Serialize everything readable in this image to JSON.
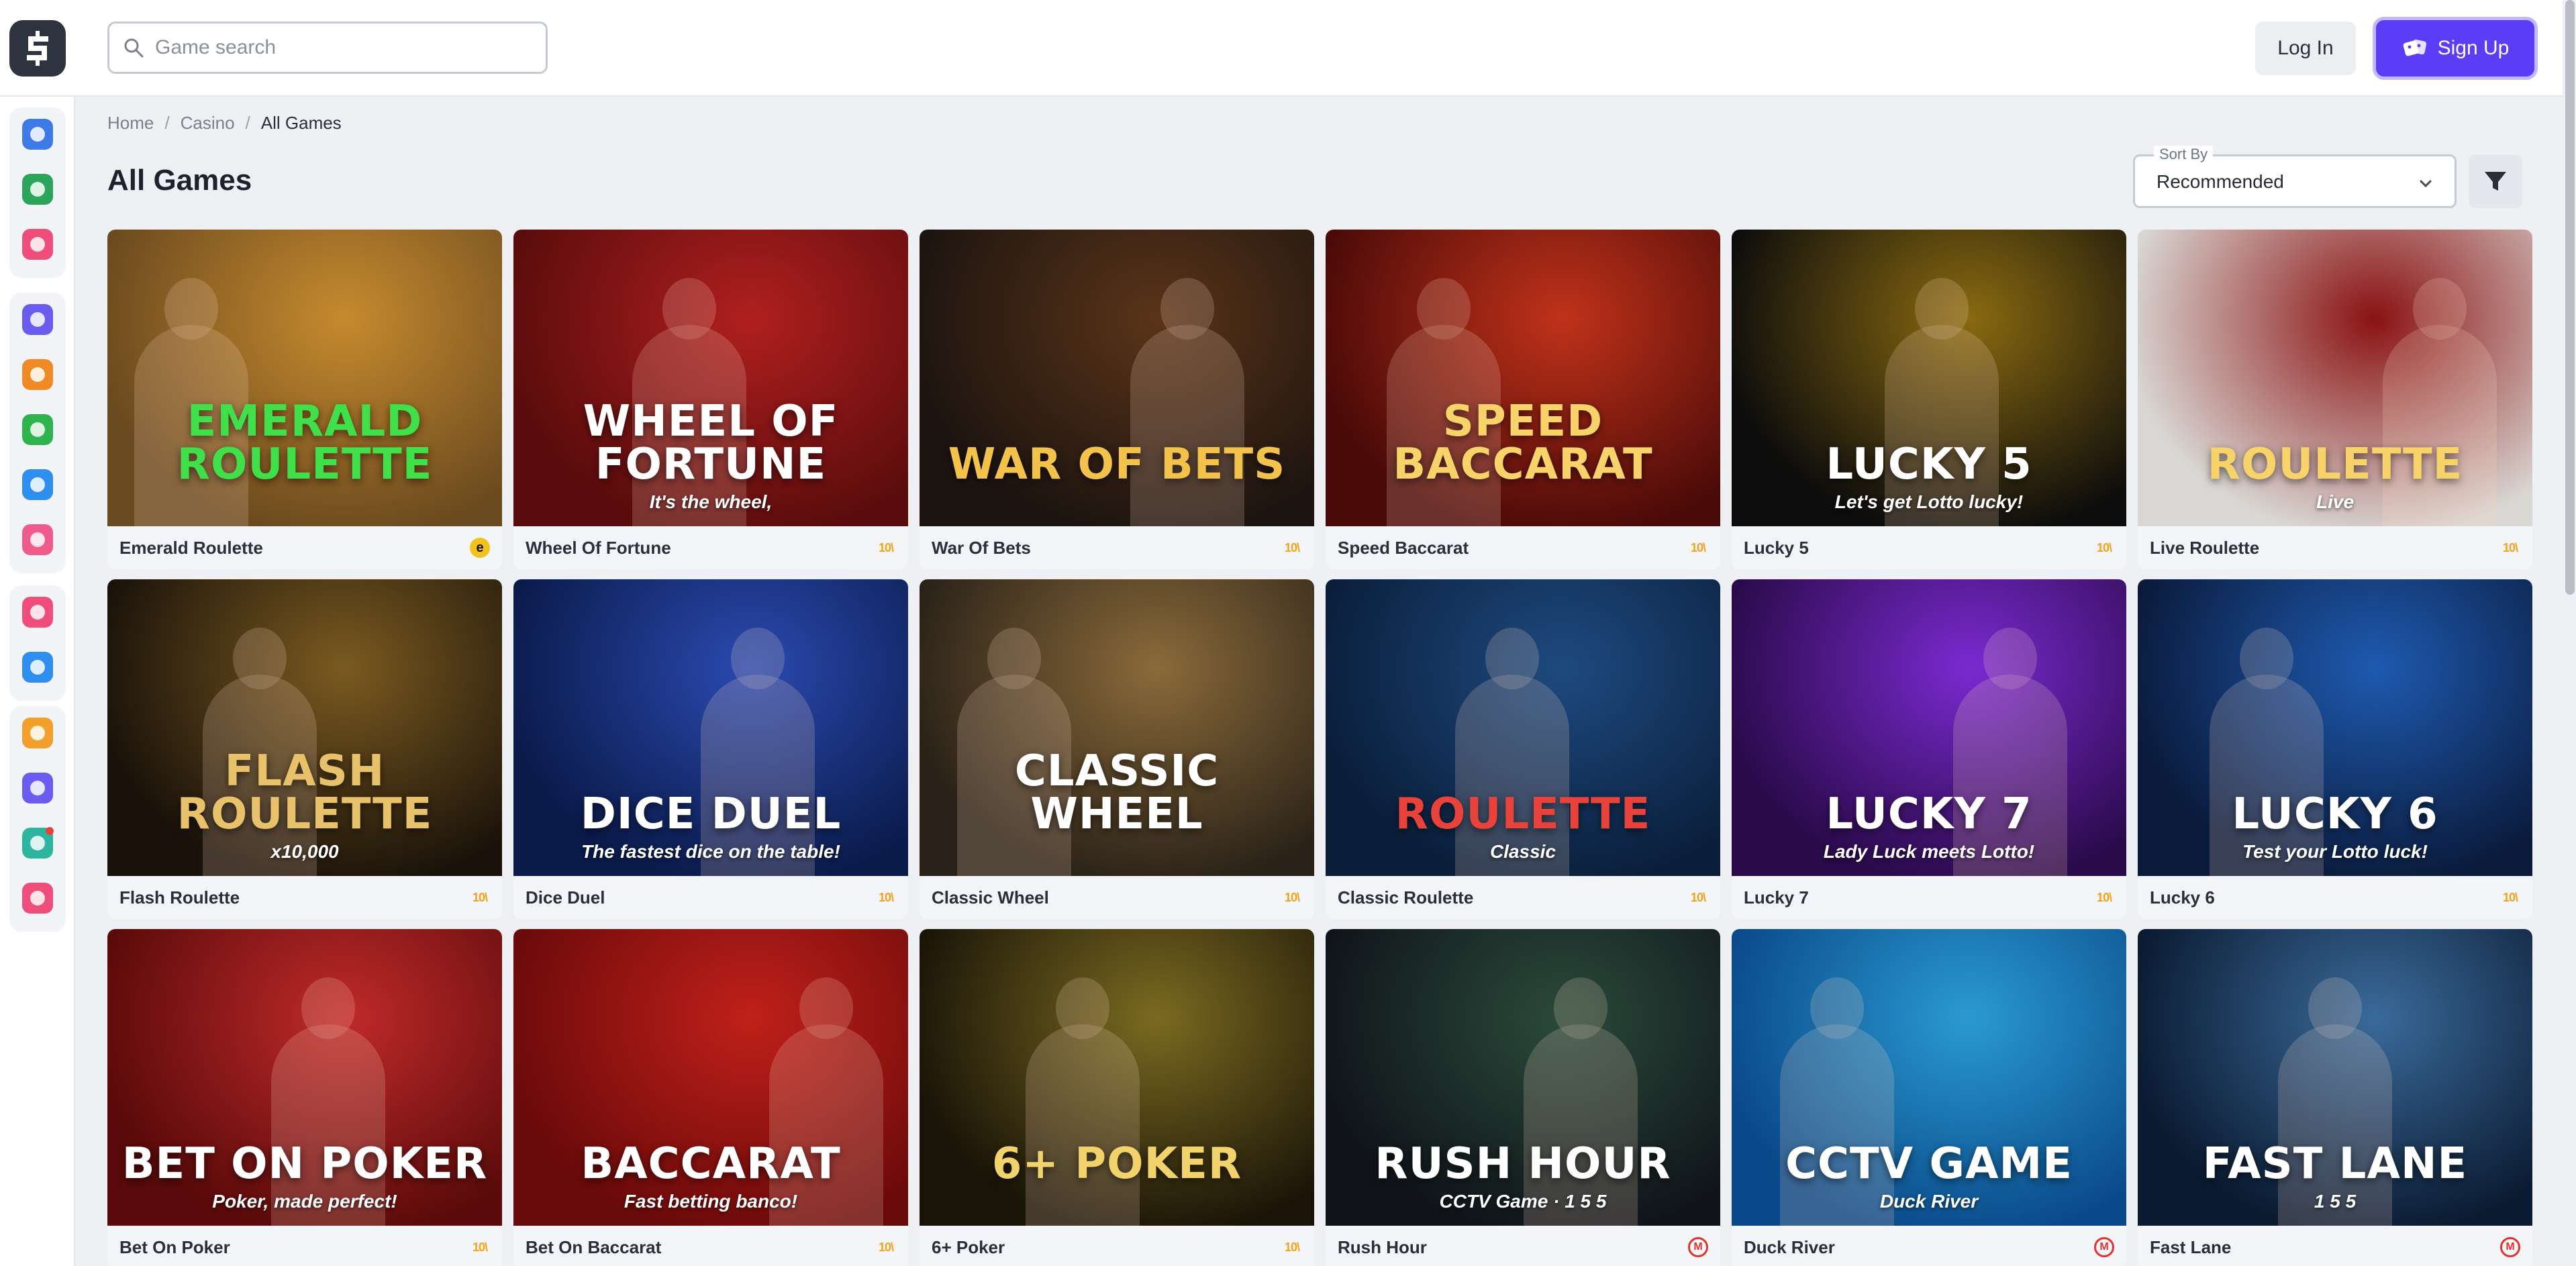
{
  "header": {
    "search_placeholder": "Game search",
    "login_label": "Log In",
    "signup_label": "Sign Up"
  },
  "sidebar": {
    "items": [
      {
        "icon": "dice-icon",
        "color": "#3d7be8"
      },
      {
        "icon": "chip-icon",
        "color": "#2aa55a"
      },
      {
        "icon": "heart-icon",
        "color": "#ef4e7b"
      },
      {
        "icon": "grid-icon",
        "color": "#6a5cf0"
      },
      {
        "icon": "trophy-icon",
        "color": "#f08a24"
      },
      {
        "icon": "percent-icon",
        "color": "#2fb34d"
      },
      {
        "icon": "target-icon",
        "color": "#2f8ff0"
      },
      {
        "icon": "cards-icon",
        "color": "#ef5b8a"
      },
      {
        "icon": "gift-icon",
        "color": "#ef4e7b"
      },
      {
        "icon": "coins-icon",
        "color": "#2f8ff0"
      },
      {
        "icon": "vip-icon",
        "color": "#f2a02a"
      },
      {
        "icon": "calendar-icon",
        "color": "#6a5cf0"
      },
      {
        "icon": "news-icon",
        "color": "#2cb59f"
      },
      {
        "icon": "chat-icon",
        "color": "#ef4e7b"
      }
    ]
  },
  "breadcrumb": {
    "home": "Home",
    "casino": "Casino",
    "current": "All Games",
    "separator": "/"
  },
  "page": {
    "title": "All Games",
    "sort_legend": "Sort By",
    "sort_value": "Recommended"
  },
  "games": [
    {
      "name": "Emerald Roulette",
      "art": "Emerald Roulette",
      "sub": "",
      "provider": "evo",
      "bg1": "#6b4a1f",
      "bg2": "#c68a2e",
      "title_color": "#3fe04a"
    },
    {
      "name": "Wheel Of Fortune",
      "art": "Wheel Of Fortune",
      "sub": "It's the wheel,",
      "provider": "ezugi",
      "bg1": "#5a0c0c",
      "bg2": "#b01f1f",
      "title_color": "#ffffff"
    },
    {
      "name": "War Of Bets",
      "art": "War Of Bets",
      "sub": "",
      "provider": "ezugi",
      "bg1": "#1c1410",
      "bg2": "#5a3418",
      "title_color": "#f2c24a"
    },
    {
      "name": "Speed Baccarat",
      "art": "Speed Baccarat",
      "sub": "",
      "provider": "ezugi",
      "bg1": "#4a0a08",
      "bg2": "#c0321a",
      "title_color": "#f7d36a"
    },
    {
      "name": "Lucky 5",
      "art": "Lucky 5",
      "sub": "Let's get Lotto lucky!",
      "provider": "ezugi",
      "bg1": "#0c0c0c",
      "bg2": "#8a6a10",
      "title_color": "#ffffff"
    },
    {
      "name": "Live Roulette",
      "art": "Roulette",
      "sub": "Live",
      "provider": "ezugi",
      "bg1": "#d9d7d3",
      "bg2": "#8a1212",
      "title_color": "#f7d36a"
    },
    {
      "name": "Flash Roulette",
      "art": "Flash Roulette",
      "sub": "x10,000",
      "provider": "ezugi",
      "bg1": "#1a120a",
      "bg2": "#7a5a20",
      "title_color": "#e8c26a"
    },
    {
      "name": "Dice Duel",
      "art": "Dice Duel",
      "sub": "The fastest dice on the table!",
      "provider": "ezugi",
      "bg1": "#0a1a4a",
      "bg2": "#2a4ab0",
      "title_color": "#ffffff"
    },
    {
      "name": "Classic Wheel",
      "art": "Classic Wheel",
      "sub": "",
      "provider": "ezugi",
      "bg1": "#2a2218",
      "bg2": "#8a6a3a",
      "title_color": "#ffffff"
    },
    {
      "name": "Classic Roulette",
      "art": "Roulette",
      "sub": "Classic",
      "provider": "ezugi",
      "bg1": "#0a1e3a",
      "bg2": "#1e4a80",
      "title_color": "#e8423a"
    },
    {
      "name": "Lucky 7",
      "art": "Lucky 7",
      "sub": "Lady Luck meets Lotto!",
      "provider": "ezugi",
      "bg1": "#2a0a4a",
      "bg2": "#7a2ad0",
      "title_color": "#ffffff"
    },
    {
      "name": "Lucky 6",
      "art": "Lucky 6",
      "sub": "Test your Lotto luck!",
      "provider": "ezugi",
      "bg1": "#0a1a3a",
      "bg2": "#1e5ab0",
      "title_color": "#ffffff"
    },
    {
      "name": "Bet On Poker",
      "art": "Bet On Poker",
      "sub": "Poker, made perfect!",
      "provider": "ezugi",
      "bg1": "#5a0a0a",
      "bg2": "#c02a2a",
      "title_color": "#ffffff"
    },
    {
      "name": "Bet On Baccarat",
      "art": "Baccarat",
      "sub": "Fast betting banco!",
      "provider": "ezugi",
      "bg1": "#6a0a0a",
      "bg2": "#c0201a",
      "title_color": "#ffffff"
    },
    {
      "name": "6+ Poker",
      "art": "6+ Poker",
      "sub": "",
      "provider": "ezugi",
      "bg1": "#1a1408",
      "bg2": "#7a6a20",
      "title_color": "#f2d26a"
    },
    {
      "name": "Rush Hour",
      "art": "Rush Hour",
      "sub": "CCTV Game · 1 5 5",
      "provider": "mplay",
      "bg1": "#10141a",
      "bg2": "#2a4a3a",
      "title_color": "#ffffff"
    },
    {
      "name": "Duck River",
      "art": "CCTV Game",
      "sub": "Duck River",
      "provider": "mplay",
      "bg1": "#0a4a8a",
      "bg2": "#2a9ad0",
      "title_color": "#ffffff"
    },
    {
      "name": "Fast Lane",
      "art": "Fast Lane",
      "sub": "1 5 5",
      "provider": "mplay",
      "bg1": "#0a1a30",
      "bg2": "#3a6a9a",
      "title_color": "#ffffff"
    }
  ],
  "providers": {
    "ezugi": "10\\",
    "evo": "e",
    "mplay": "M"
  }
}
